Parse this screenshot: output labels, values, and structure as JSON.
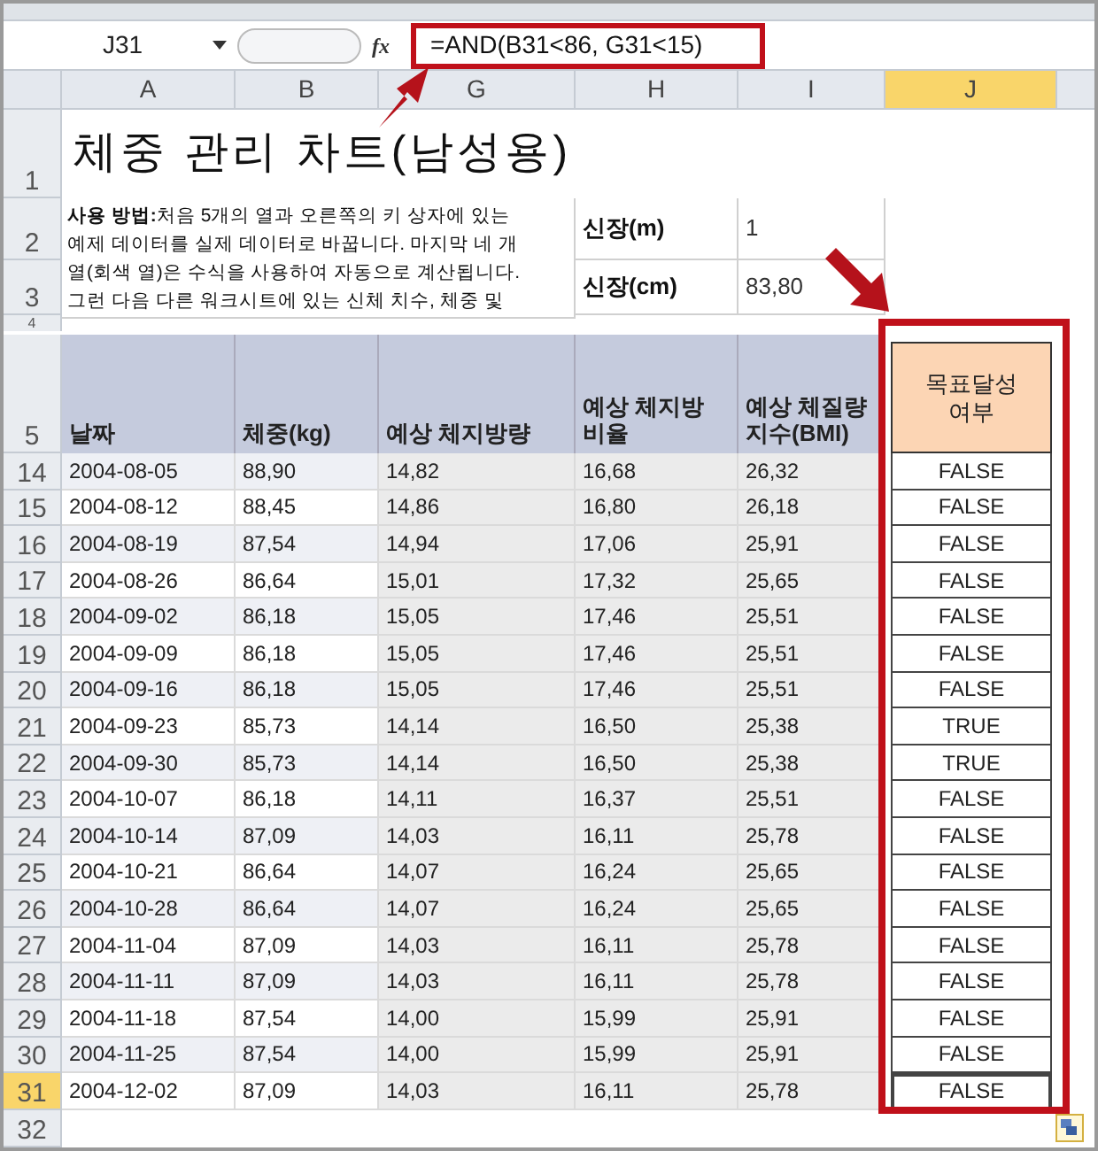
{
  "formula_bar": {
    "name_box": "J31",
    "function_label": "fx",
    "formula": "=AND(B31<86, G31<15)"
  },
  "columns": [
    {
      "label": "A",
      "selected": false
    },
    {
      "label": "B",
      "selected": false
    },
    {
      "label": "G",
      "selected": false
    },
    {
      "label": "H",
      "selected": false
    },
    {
      "label": "I",
      "selected": false
    },
    {
      "label": "J",
      "selected": true
    }
  ],
  "title_row": {
    "row": "1",
    "title": "체중 관리 차트(남성용)"
  },
  "info": {
    "rows": [
      "2",
      "3",
      "4"
    ],
    "instructions": [
      "**사용 방법:**처음 5개의 열과 오른쪽의 키 상자에 있는",
      "예제 데이터를 실제 데이터로 바꿉니다. 마지막 네 개",
      "열(회색 열)은 수식을 사용하여 자동으로 계산됩니다.",
      "그런 다음 다른 워크시트에 있는 신체 치수, 체중 및"
    ],
    "heights": [
      {
        "label": "신장(m)",
        "value": "1"
      },
      {
        "label": "신장(cm)",
        "value": "83,80"
      }
    ]
  },
  "table": {
    "header_row": "5",
    "columns": [
      "날짜",
      "체중(kg)",
      "예상 체지방량",
      "예상 체지방 비율",
      "예상 체질량 지수(BMI)",
      "목표달성 여부"
    ],
    "rows": [
      {
        "row": "14",
        "cells": [
          "2004-08-05",
          "88,90",
          "14,82",
          "16,68",
          "26,32"
        ],
        "result": "FALSE",
        "selected": false
      },
      {
        "row": "15",
        "cells": [
          "2004-08-12",
          "88,45",
          "14,86",
          "16,80",
          "26,18"
        ],
        "result": "FALSE",
        "selected": false
      },
      {
        "row": "16",
        "cells": [
          "2004-08-19",
          "87,54",
          "14,94",
          "17,06",
          "25,91"
        ],
        "result": "FALSE",
        "selected": false
      },
      {
        "row": "17",
        "cells": [
          "2004-08-26",
          "86,64",
          "15,01",
          "17,32",
          "25,65"
        ],
        "result": "FALSE",
        "selected": false
      },
      {
        "row": "18",
        "cells": [
          "2004-09-02",
          "86,18",
          "15,05",
          "17,46",
          "25,51"
        ],
        "result": "FALSE",
        "selected": false
      },
      {
        "row": "19",
        "cells": [
          "2004-09-09",
          "86,18",
          "15,05",
          "17,46",
          "25,51"
        ],
        "result": "FALSE",
        "selected": false
      },
      {
        "row": "20",
        "cells": [
          "2004-09-16",
          "86,18",
          "15,05",
          "17,46",
          "25,51"
        ],
        "result": "FALSE",
        "selected": false
      },
      {
        "row": "21",
        "cells": [
          "2004-09-23",
          "85,73",
          "14,14",
          "16,50",
          "25,38"
        ],
        "result": "TRUE",
        "selected": false
      },
      {
        "row": "22",
        "cells": [
          "2004-09-30",
          "85,73",
          "14,14",
          "16,50",
          "25,38"
        ],
        "result": "TRUE",
        "selected": false
      },
      {
        "row": "23",
        "cells": [
          "2004-10-07",
          "86,18",
          "14,11",
          "16,37",
          "25,51"
        ],
        "result": "FALSE",
        "selected": false
      },
      {
        "row": "24",
        "cells": [
          "2004-10-14",
          "87,09",
          "14,03",
          "16,11",
          "25,78"
        ],
        "result": "FALSE",
        "selected": false
      },
      {
        "row": "25",
        "cells": [
          "2004-10-21",
          "86,64",
          "14,07",
          "16,24",
          "25,65"
        ],
        "result": "FALSE",
        "selected": false
      },
      {
        "row": "26",
        "cells": [
          "2004-10-28",
          "86,64",
          "14,07",
          "16,24",
          "25,65"
        ],
        "result": "FALSE",
        "selected": false
      },
      {
        "row": "27",
        "cells": [
          "2004-11-04",
          "87,09",
          "14,03",
          "16,11",
          "25,78"
        ],
        "result": "FALSE",
        "selected": false
      },
      {
        "row": "28",
        "cells": [
          "2004-11-11",
          "87,09",
          "14,03",
          "16,11",
          "25,78"
        ],
        "result": "FALSE",
        "selected": false
      },
      {
        "row": "29",
        "cells": [
          "2004-11-18",
          "87,54",
          "14,00",
          "15,99",
          "25,91"
        ],
        "result": "FALSE",
        "selected": false
      },
      {
        "row": "30",
        "cells": [
          "2004-11-25",
          "87,54",
          "14,00",
          "15,99",
          "25,91"
        ],
        "result": "FALSE",
        "selected": false
      },
      {
        "row": "31",
        "cells": [
          "2004-12-02",
          "87,09",
          "14,03",
          "16,11",
          "25,78"
        ],
        "result": "FALSE",
        "selected": true
      }
    ]
  },
  "extra_row": "32"
}
